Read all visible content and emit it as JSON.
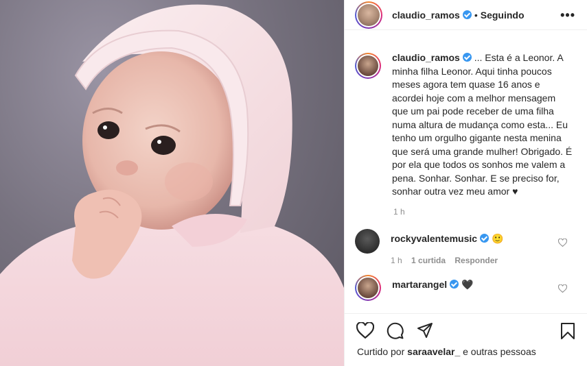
{
  "post": {
    "author": "claudio_ramos",
    "follow_status": "Seguindo",
    "separator": "•",
    "more_label": "•••"
  },
  "caption": {
    "author": "claudio_ramos",
    "text": "... Esta é a Leonor. A minha filha Leonor. Aqui tinha poucos meses agora tem quase 16 anos e acordei hoje com a melhor mensagem que um pai pode receber de uma filha numa altura de mudança como esta... Eu tenho um orgulho gigante nesta menina que será uma grande mulher! Obrigado. É por ela que todos os sonhos me valem a pena. Sonhar. Sonhar. E se preciso for, sonhar outra vez meu amor ♥",
    "time": "1 h"
  },
  "comments": [
    {
      "author": "rockyvalentemusic",
      "text": "🙂",
      "time": "1 h",
      "likes": "1 curtida",
      "reply_label": "Responder"
    },
    {
      "author": "martarangel",
      "text": "🖤"
    }
  ],
  "likes_bar": {
    "prefix": "Curtido por",
    "user": "saraavelar_",
    "suffix": "e outras pessoas"
  },
  "icons": {
    "like": "heart-icon",
    "comment": "comment-icon",
    "share": "paper-plane-icon",
    "save": "bookmark-icon",
    "more": "more-icon"
  },
  "colors": {
    "verified": "#3897f0",
    "muted": "#8e8e8e",
    "text": "#262626"
  }
}
